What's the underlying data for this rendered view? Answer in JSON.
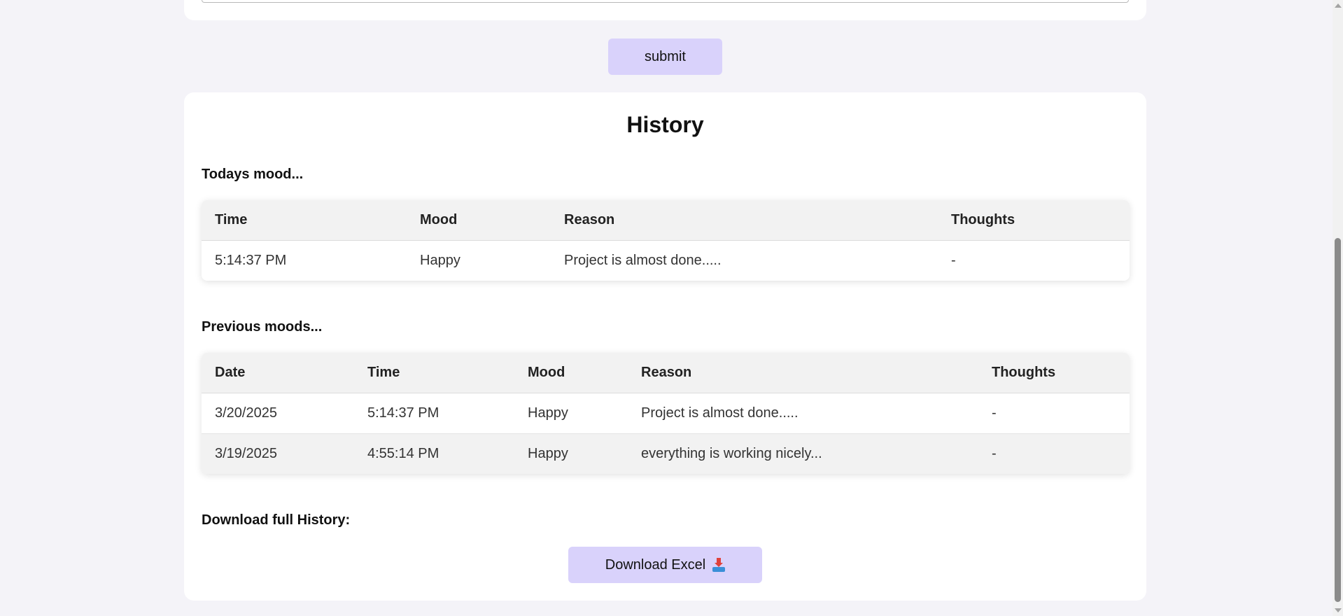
{
  "form": {
    "submit_label": "submit"
  },
  "history": {
    "title": "History",
    "today_label": "Todays mood...",
    "today_table": {
      "headers": [
        "Time",
        "Mood",
        "Reason",
        "Thoughts"
      ],
      "rows": [
        [
          "5:14:37 PM",
          "Happy",
          "Project is almost done.....",
          "-"
        ]
      ]
    },
    "previous_label": "Previous moods...",
    "previous_table": {
      "headers": [
        "Date",
        "Time",
        "Mood",
        "Reason",
        "Thoughts"
      ],
      "rows": [
        [
          "3/20/2025",
          "5:14:37 PM",
          "Happy",
          "Project is almost done.....",
          "-"
        ],
        [
          "3/19/2025",
          "4:55:14 PM",
          "Happy",
          "everything is working nicely...",
          "-"
        ]
      ]
    },
    "download_label": "Download full History:",
    "download_button_label": "Download Excel",
    "download_button_icon": "inbox-tray-icon"
  }
}
